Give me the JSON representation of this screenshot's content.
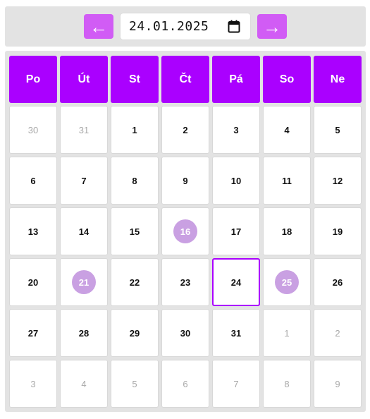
{
  "toolbar": {
    "prev_label": "←",
    "next_label": "→",
    "date_value": "24.01.2025"
  },
  "weekdays": [
    "Po",
    "Út",
    "St",
    "Čt",
    "Pá",
    "So",
    "Ne"
  ],
  "weeks": [
    [
      {
        "d": "30",
        "other": true
      },
      {
        "d": "31",
        "other": true
      },
      {
        "d": "1"
      },
      {
        "d": "2"
      },
      {
        "d": "3"
      },
      {
        "d": "4"
      },
      {
        "d": "5"
      }
    ],
    [
      {
        "d": "6"
      },
      {
        "d": "7"
      },
      {
        "d": "8"
      },
      {
        "d": "9"
      },
      {
        "d": "10"
      },
      {
        "d": "11"
      },
      {
        "d": "12"
      }
    ],
    [
      {
        "d": "13"
      },
      {
        "d": "14"
      },
      {
        "d": "15"
      },
      {
        "d": "16",
        "marked": true
      },
      {
        "d": "17"
      },
      {
        "d": "18"
      },
      {
        "d": "19"
      }
    ],
    [
      {
        "d": "20"
      },
      {
        "d": "21",
        "marked": true
      },
      {
        "d": "22"
      },
      {
        "d": "23"
      },
      {
        "d": "24",
        "today": true
      },
      {
        "d": "25",
        "marked": true
      },
      {
        "d": "26"
      }
    ],
    [
      {
        "d": "27"
      },
      {
        "d": "28"
      },
      {
        "d": "29"
      },
      {
        "d": "30"
      },
      {
        "d": "31"
      },
      {
        "d": "1",
        "other": true
      },
      {
        "d": "2",
        "other": true
      }
    ],
    [
      {
        "d": "3",
        "other": true
      },
      {
        "d": "4",
        "other": true
      },
      {
        "d": "5",
        "other": true
      },
      {
        "d": "6",
        "other": true
      },
      {
        "d": "7",
        "other": true
      },
      {
        "d": "8",
        "other": true
      },
      {
        "d": "9",
        "other": true
      }
    ]
  ],
  "colors": {
    "accent": "#aa00ff",
    "nav_button": "#d15cf5",
    "marked_day": "#c9a0e2",
    "other_month_text": "#a9a9a9",
    "panel_bg": "#e3e3e3"
  },
  "icons": {
    "prev": "arrow-left-icon",
    "next": "arrow-right-icon",
    "date_picker": "calendar-icon"
  }
}
